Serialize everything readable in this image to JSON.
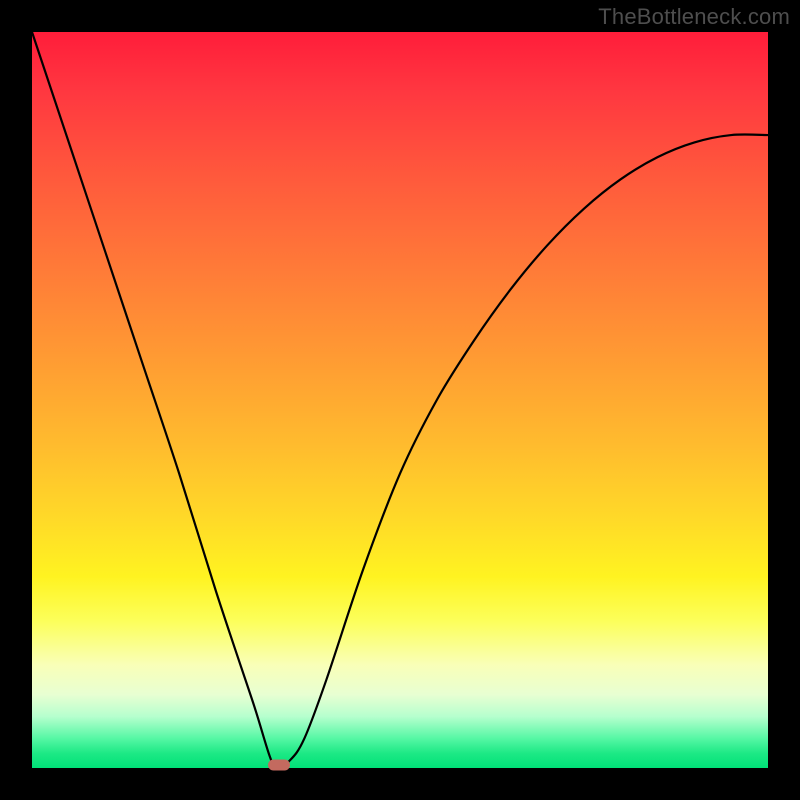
{
  "watermark": "TheBottleneck.com",
  "chart_data": {
    "type": "line",
    "title": "",
    "xlabel": "",
    "ylabel": "",
    "xlim": [
      0,
      1
    ],
    "ylim": [
      0,
      1
    ],
    "background_gradient": {
      "orientation": "vertical",
      "stops": [
        {
          "pos": 0.0,
          "color": "#ff1d3a"
        },
        {
          "pos": 0.4,
          "color": "#ff9a33"
        },
        {
          "pos": 0.74,
          "color": "#fff321"
        },
        {
          "pos": 0.9,
          "color": "#e8ffd2"
        },
        {
          "pos": 1.0,
          "color": "#00e178"
        }
      ]
    },
    "series": [
      {
        "name": "bottleneck-curve",
        "color": "#000000",
        "x": [
          0.0,
          0.05,
          0.1,
          0.15,
          0.2,
          0.25,
          0.3,
          0.33,
          0.35,
          0.37,
          0.4,
          0.45,
          0.5,
          0.55,
          0.6,
          0.65,
          0.7,
          0.75,
          0.8,
          0.85,
          0.9,
          0.95,
          1.0
        ],
        "y": [
          1.0,
          0.85,
          0.7,
          0.55,
          0.4,
          0.24,
          0.09,
          0.0,
          0.01,
          0.04,
          0.12,
          0.27,
          0.4,
          0.5,
          0.58,
          0.65,
          0.71,
          0.76,
          0.8,
          0.83,
          0.85,
          0.86,
          0.86
        ]
      }
    ],
    "marker": {
      "name": "optimum-point",
      "x": 0.335,
      "y": 0.0,
      "color": "#c36a5f"
    }
  }
}
